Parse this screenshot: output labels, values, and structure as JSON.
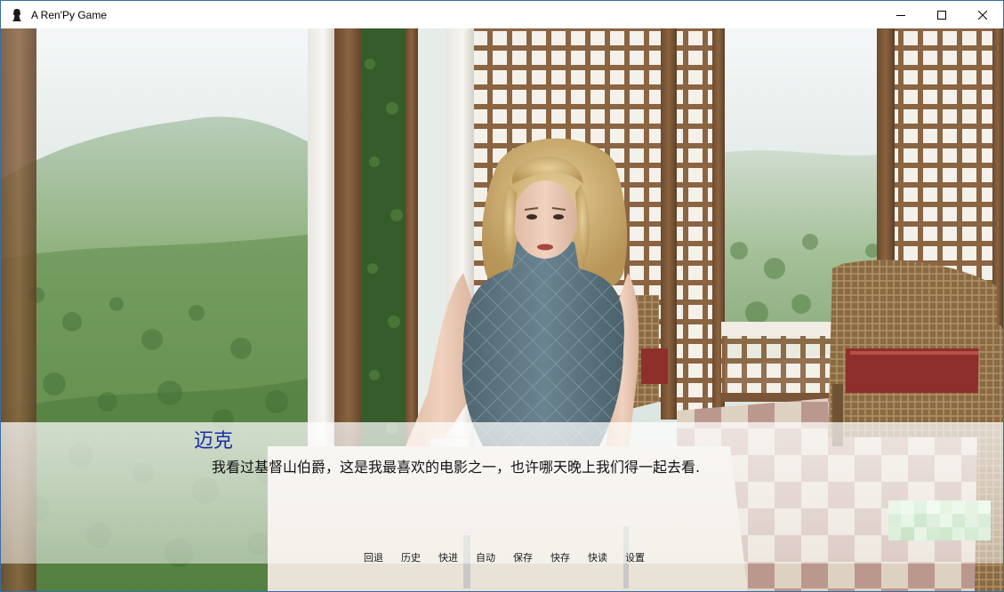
{
  "window": {
    "title": "A Ren'Py Game",
    "icon": "renpy-icon",
    "controls": [
      "minimize-icon",
      "maximize-icon",
      "close-icon"
    ]
  },
  "scene": {
    "location": "restaurant-terrace",
    "character": "blonde-woman-gray-knit-dress"
  },
  "dialogue": {
    "speaker": "迈克",
    "speaker_color": "#1d2ea6",
    "text": "我看过基督山伯爵，这是我最喜欢的电影之一，也许哪天晚上我们得一起去看."
  },
  "quick_menu": {
    "items": [
      {
        "key": "rollback",
        "label": "回退"
      },
      {
        "key": "history",
        "label": "历史"
      },
      {
        "key": "skip",
        "label": "快进"
      },
      {
        "key": "auto",
        "label": "自动"
      },
      {
        "key": "save",
        "label": "保存"
      },
      {
        "key": "quicksave",
        "label": "快存"
      },
      {
        "key": "quickload",
        "label": "快读"
      },
      {
        "key": "preferences",
        "label": "设置"
      }
    ]
  }
}
